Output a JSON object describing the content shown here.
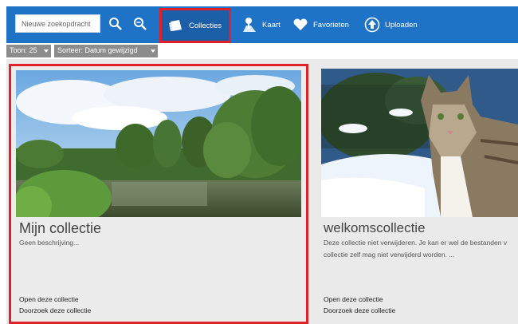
{
  "toolbar": {
    "search_placeholder": "Nieuwe zoekopdracht",
    "collecties_label": "Collecties",
    "kaart_label": "Kaart",
    "favorieten_label": "Favorieten",
    "uploaden_label": "Uploaden"
  },
  "filters": {
    "toon_label": "Toon: 25",
    "sorteer_label": "Sorteer: Datum gewijzigd"
  },
  "collections": [
    {
      "title": "Mijn collectie",
      "description": "Geen beschrijving...",
      "open_link": "Open deze collectie",
      "search_link": "Doorzoek deze collectie"
    },
    {
      "title": "welkomscollectie",
      "description": "Deze collectie niet verwijderen. Je kan er wel de bestanden v collectie zelf mag niet verwijderd worden. ...",
      "open_link": "Open deze collectie",
      "search_link": "Doorzoek deze collectie"
    }
  ],
  "colors": {
    "topbar": "#1f73c6",
    "highlight": "#e0202a",
    "content_bg": "#eaeaea"
  }
}
